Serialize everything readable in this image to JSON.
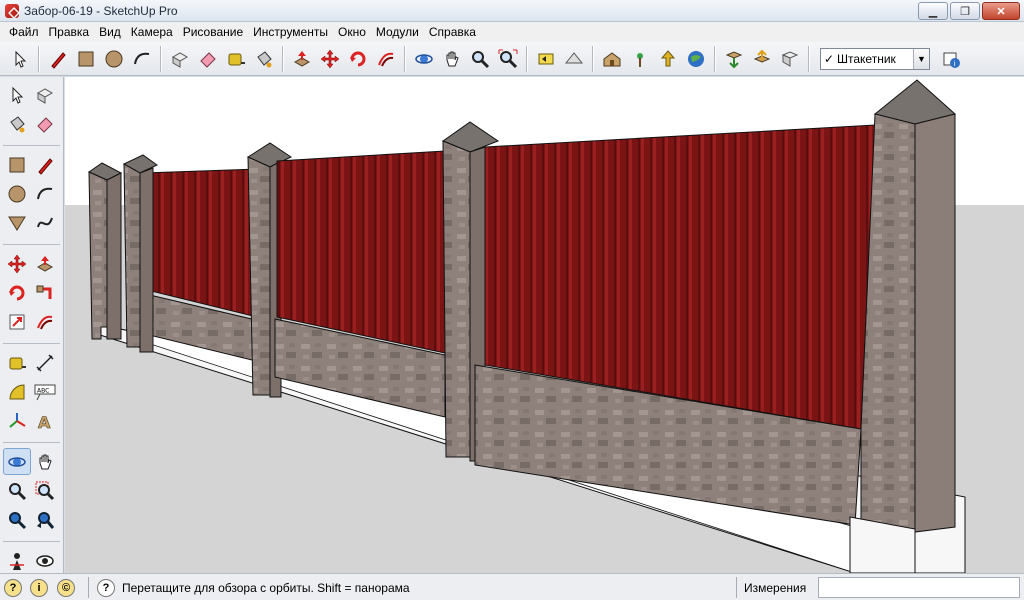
{
  "window": {
    "title": "Забор-06-19 - SketchUp Pro"
  },
  "menu": [
    "Файл",
    "Правка",
    "Вид",
    "Камера",
    "Рисование",
    "Инструменты",
    "Окно",
    "Модули",
    "Справка"
  ],
  "toolbar": {
    "scene_label": "Штакетник",
    "scene_checked": "✓"
  },
  "status": {
    "hint": "Перетащите для обзора с орбиты.  Shift = панорама",
    "measurements_label": "Измерения",
    "measurements_value": ""
  },
  "colors": {
    "sky": "#ffffff",
    "ground": "#d4d4d4",
    "panel": "#7a1616",
    "stone": "#8d7f7a",
    "cap": "#7d7874"
  }
}
